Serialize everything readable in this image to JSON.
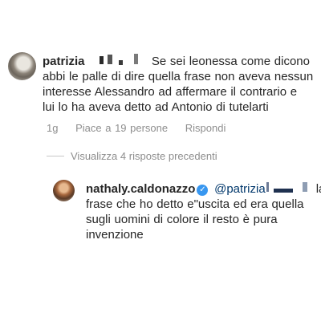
{
  "comment": {
    "username": "patrizia",
    "text_lines": [
      "Se sei leonessa come dicono",
      "abbi le palle di dire quella frase non aveva nessun",
      "interesse Alessandro ad affermare il contrario e",
      "lui lo ha aveva detto ad Antonio di tutelarti"
    ],
    "time": "1g",
    "likes": "Piace a 19 persone",
    "reply_label": "Rispondi"
  },
  "view_replies": "Visualizza 4 risposte precedenti",
  "reply": {
    "username": "nathaly.caldonazzo",
    "verified_icon": "verified-badge-icon",
    "mention": "@patrizia",
    "trailing": "la",
    "text_lines": [
      "frase che ho detto e\"uscita ed era quella",
      "sugli uomini di colore il resto è pura",
      "invenzione"
    ]
  },
  "colors": {
    "text": "#262626",
    "secondary": "#8e8e8e",
    "mention": "#00376b",
    "verified": "#3897f0"
  }
}
